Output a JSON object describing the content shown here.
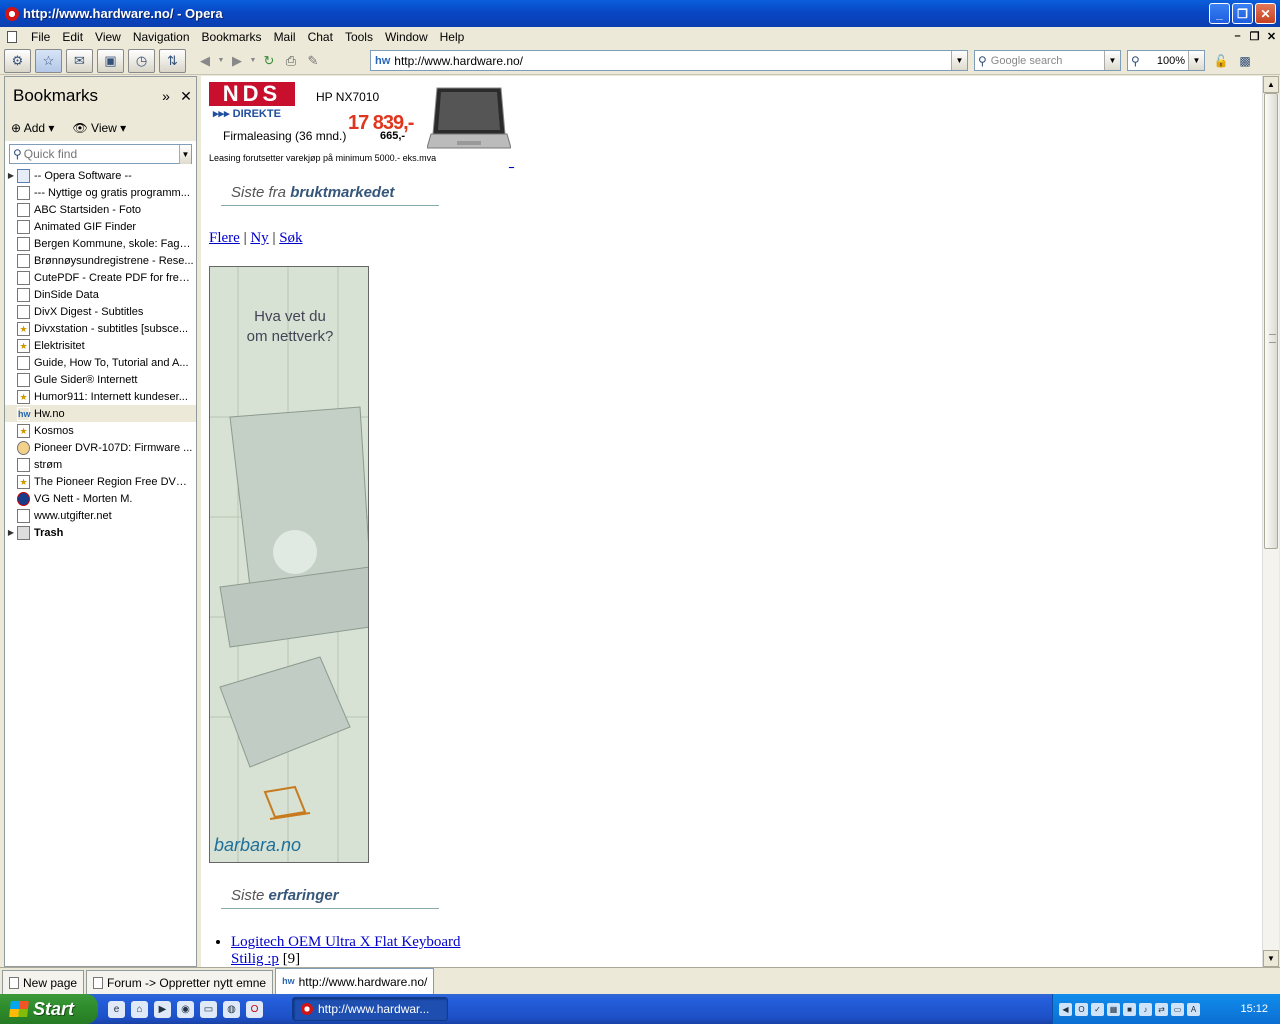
{
  "window": {
    "title": "http://www.hardware.no/ - Opera"
  },
  "menu": [
    "File",
    "Edit",
    "View",
    "Navigation",
    "Bookmarks",
    "Mail",
    "Chat",
    "Tools",
    "Window",
    "Help"
  ],
  "toolbar": {
    "address": "http://www.hardware.no/",
    "address_badge": "hw",
    "search_placeholder": "Google search",
    "zoom": "100%"
  },
  "panel": {
    "title": "Bookmarks",
    "add_label": "Add",
    "view_label": "View",
    "quickfind_placeholder": "Quick find",
    "items": [
      {
        "label": "-- Opera Software --",
        "type": "folder"
      },
      {
        "label": "--- Nyttige og gratis programm...",
        "type": "page"
      },
      {
        "label": "ABC Startsiden -  Foto",
        "type": "page"
      },
      {
        "label": "Animated GIF Finder",
        "type": "page"
      },
      {
        "label": "Bergen Kommune, skole: Fagsi...",
        "type": "page"
      },
      {
        "label": "Brønnøysundregistrene - Rese...",
        "type": "page"
      },
      {
        "label": "CutePDF - Create PDF for free...",
        "type": "page"
      },
      {
        "label": "DinSide Data",
        "type": "page"
      },
      {
        "label": "DivX Digest - Subtitles",
        "type": "page"
      },
      {
        "label": "Divxstation - subtitles [subsce...",
        "type": "star"
      },
      {
        "label": "Elektrisitet",
        "type": "star"
      },
      {
        "label": "Guide, How To, Tutorial and A...",
        "type": "page"
      },
      {
        "label": "Gule Sider® Internett",
        "type": "page"
      },
      {
        "label": "Humor911: Internett kundeser...",
        "type": "star"
      },
      {
        "label": "Hw.no",
        "type": "hw"
      },
      {
        "label": "Kosmos",
        "type": "star"
      },
      {
        "label": "Pioneer DVR-107D: Firmware ...",
        "type": "page"
      },
      {
        "label": "strøm",
        "type": "page"
      },
      {
        "label": "The Pioneer Region Free DVD ...",
        "type": "star"
      },
      {
        "label": "VG Nett - Morten M.",
        "type": "vg"
      },
      {
        "label": "www.utgifter.net",
        "type": "page"
      },
      {
        "label": "Trash",
        "type": "trash"
      }
    ]
  },
  "content": {
    "ad": {
      "brand": "NDS",
      "brand_sub": "▸▸▸ DIREKTE",
      "model": "HP NX7010",
      "price": "17 839,-",
      "lease": "Firmaleasing (36 mnd.)",
      "lease_price": "665,-",
      "condition": "Leasing forutsetter varekjøp på minimum 5000.- eks.mva",
      "link": "_"
    },
    "section1": {
      "prefix": "Siste fra",
      "bold": "bruktmarkedet"
    },
    "links": [
      "Flere",
      "Ny",
      "Søk"
    ],
    "banner": {
      "question_1": "Hva vet du",
      "question_2": "om nettverk?",
      "brand": "barbara.no"
    },
    "section2": {
      "prefix": "Siste",
      "bold": "erfaringer"
    },
    "list": [
      {
        "title": "Logitech OEM Ultra X Flat Keyboard",
        "sub": "Stilig :p",
        "count": "[9]"
      }
    ]
  },
  "tabs": [
    {
      "label": "New page"
    },
    {
      "label": "Forum -> Oppretter nytt emne"
    },
    {
      "label": "http://www.hardware.no/"
    }
  ],
  "taskbar": {
    "start": "Start",
    "task": "http://www.hardwar...",
    "clock": "15:12"
  }
}
